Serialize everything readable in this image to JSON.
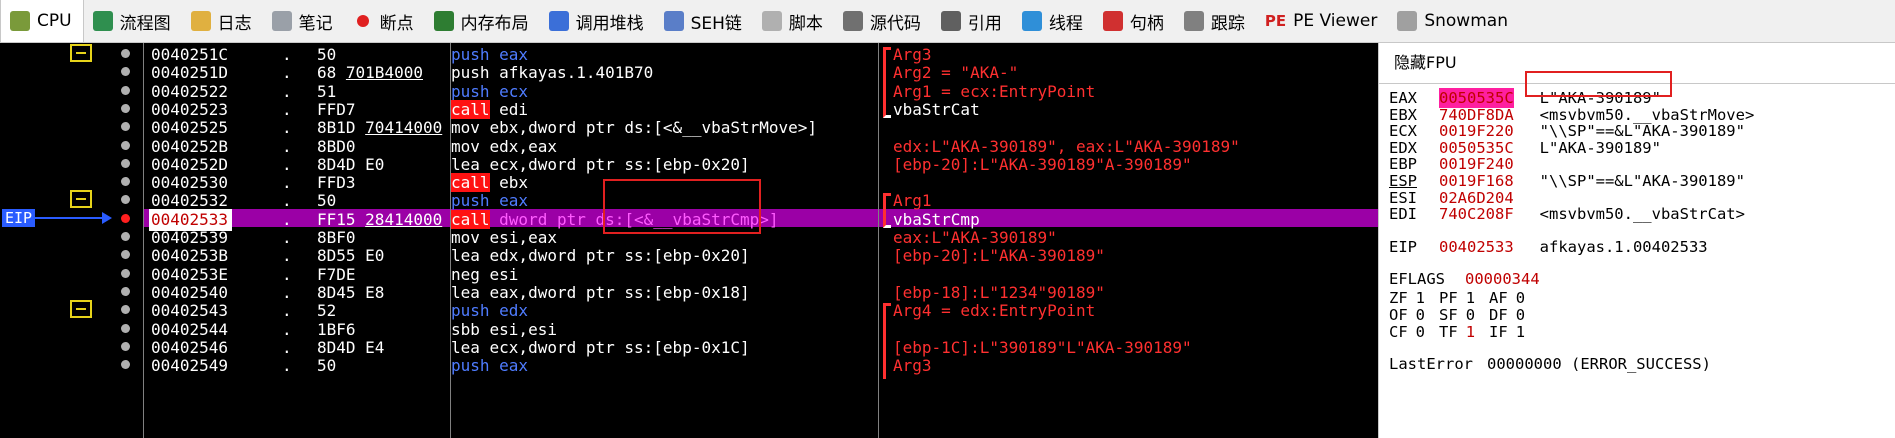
{
  "tabs": [
    {
      "label": "CPU",
      "icon": "cpu-icon",
      "active": true
    },
    {
      "label": "流程图",
      "icon": "graph-icon"
    },
    {
      "label": "日志",
      "icon": "log-icon"
    },
    {
      "label": "笔记",
      "icon": "notes-icon"
    },
    {
      "label": "断点",
      "icon": "breakpoint-icon"
    },
    {
      "label": "内存布局",
      "icon": "memory-map-icon"
    },
    {
      "label": "调用堆栈",
      "icon": "call-stack-icon"
    },
    {
      "label": "SEH链",
      "icon": "seh-icon"
    },
    {
      "label": "脚本",
      "icon": "script-icon"
    },
    {
      "label": "源代码",
      "icon": "source-icon"
    },
    {
      "label": "引用",
      "icon": "references-icon"
    },
    {
      "label": "线程",
      "icon": "threads-icon"
    },
    {
      "label": "句柄",
      "icon": "handles-icon"
    },
    {
      "label": "跟踪",
      "icon": "trace-icon"
    },
    {
      "label": "PE Viewer",
      "icon": "pe-viewer-icon"
    },
    {
      "label": "Snowman",
      "icon": "snowman-icon"
    }
  ],
  "eip_label": "EIP",
  "rows": [
    {
      "addr": "0040251C",
      "dot": ".",
      "bytes": "50",
      "bytes_ul": "",
      "instr": [
        [
          "push eax",
          "push"
        ]
      ],
      "comment": "Arg3",
      "ccls": "red"
    },
    {
      "addr": "0040251D",
      "dot": ".",
      "bytes": "68 ",
      "bytes_ul": "701B4000",
      "instr": [
        [
          "push afkayas.1.401B70",
          "w"
        ]
      ],
      "comment": "Arg2 = \"AKA-\"",
      "ccls": "red"
    },
    {
      "addr": "00402522",
      "dot": ".",
      "bytes": "51",
      "bytes_ul": "",
      "instr": [
        [
          "push ecx",
          "push"
        ]
      ],
      "comment": "Arg1 = ecx:EntryPoint",
      "ccls": "red"
    },
    {
      "addr": "00402523",
      "dot": ".",
      "bytes": "FFD7",
      "bytes_ul": "",
      "instr": [
        [
          "call",
          "call"
        ],
        [
          " edi",
          "w"
        ]
      ],
      "comment": "vbaStrCat",
      "ccls": "w"
    },
    {
      "addr": "00402525",
      "dot": ".",
      "bytes": "8B1D ",
      "bytes_ul": "70414000",
      "instr": [
        [
          "mov ebx,dword ptr ds:[<&__vbaStrMove>]",
          "w"
        ]
      ],
      "comment": "",
      "ccls": "red"
    },
    {
      "addr": "0040252B",
      "dot": ".",
      "bytes": "8BD0",
      "bytes_ul": "",
      "instr": [
        [
          "mov edx,eax",
          "w"
        ]
      ],
      "comment": "edx:L\"AKA-390189\", eax:L\"AKA-390189\"",
      "ccls": "red"
    },
    {
      "addr": "0040252D",
      "dot": ".",
      "bytes": "8D4D E0",
      "bytes_ul": "",
      "instr": [
        [
          "lea ecx,dword ptr ss:[ebp-0x20]",
          "w"
        ]
      ],
      "comment": "[ebp-20]:L\"AKA-390189\"A-390189\"",
      "ccls": "red"
    },
    {
      "addr": "00402530",
      "dot": ".",
      "bytes": "FFD3",
      "bytes_ul": "",
      "instr": [
        [
          "call",
          "call"
        ],
        [
          " ebx",
          "w"
        ]
      ],
      "comment": "",
      "ccls": "red"
    },
    {
      "addr": "00402532",
      "dot": ".",
      "bytes": "50",
      "bytes_ul": "",
      "instr": [
        [
          "push eax",
          "push"
        ]
      ],
      "comment": "Arg1",
      "ccls": "red"
    },
    {
      "addr": "00402533",
      "dot": ".",
      "bytes": "FF15 ",
      "bytes_ul": "28414000",
      "instr": [
        [
          "call",
          "call"
        ],
        [
          " dword ptr ds:[<&__vbaStrCmp>]",
          "mag"
        ]
      ],
      "comment": "vbaStrCmp",
      "ccls": "w"
    },
    {
      "addr": "00402539",
      "dot": ".",
      "bytes": "8BF0",
      "bytes_ul": "",
      "instr": [
        [
          "mov esi,eax",
          "w"
        ]
      ],
      "comment": "eax:L\"AKA-390189\"",
      "ccls": "red"
    },
    {
      "addr": "0040253B",
      "dot": ".",
      "bytes": "8D55 E0",
      "bytes_ul": "",
      "instr": [
        [
          "lea edx,dword ptr ss:[ebp-0x20]",
          "w"
        ]
      ],
      "comment": "[ebp-20]:L\"AKA-390189\"",
      "ccls": "red"
    },
    {
      "addr": "0040253E",
      "dot": ".",
      "bytes": "F7DE",
      "bytes_ul": "",
      "instr": [
        [
          "neg esi",
          "w"
        ]
      ],
      "comment": "",
      "ccls": "red"
    },
    {
      "addr": "00402540",
      "dot": ".",
      "bytes": "8D45 E8",
      "bytes_ul": "",
      "instr": [
        [
          "lea eax,dword ptr ss:[ebp-0x18]",
          "w"
        ]
      ],
      "comment": "[ebp-18]:L\"1234\"90189\"",
      "ccls": "red"
    },
    {
      "addr": "00402543",
      "dot": ".",
      "bytes": "52",
      "bytes_ul": "",
      "instr": [
        [
          "push edx",
          "push"
        ]
      ],
      "comment": "Arg4 = edx:EntryPoint",
      "ccls": "red"
    },
    {
      "addr": "00402544",
      "dot": ".",
      "bytes": "1BF6",
      "bytes_ul": "",
      "instr": [
        [
          "sbb esi,esi",
          "w"
        ]
      ],
      "comment": "",
      "ccls": "red"
    },
    {
      "addr": "00402546",
      "dot": ".",
      "bytes": "8D4D E4",
      "bytes_ul": "",
      "instr": [
        [
          "lea ecx,dword ptr ss:[ebp-0x1C]",
          "w"
        ]
      ],
      "comment": "[ebp-1C]:L\"390189\"L\"AKA-390189\"",
      "ccls": "red"
    },
    {
      "addr": "00402549",
      "dot": ".",
      "bytes": "50",
      "bytes_ul": "",
      "instr": [
        [
          "push eax",
          "push"
        ]
      ],
      "comment": "Arg3",
      "ccls": "red"
    }
  ],
  "registers": {
    "header": "隐藏FPU",
    "lines": [
      {
        "name": "EAX",
        "value": "0050535C",
        "comment": "L\"AKA-390189\"",
        "vcls": "mag"
      },
      {
        "name": "EBX",
        "value": "740DF8DA",
        "comment": "<msvbvm50.__vbaStrMove>",
        "vcls": "red"
      },
      {
        "name": "ECX",
        "value": "0019F220",
        "comment": "\"\\\\SP\"==&L\"AKA-390189\"",
        "vcls": "red"
      },
      {
        "name": "EDX",
        "value": "0050535C",
        "comment": "L\"AKA-390189\"",
        "vcls": "red"
      },
      {
        "name": "EBP",
        "value": "0019F240",
        "comment": "",
        "vcls": "red"
      },
      {
        "name": "ESP",
        "value": "0019F168",
        "comment": "\"\\\\SP\"==&L\"AKA-390189\"",
        "vcls": "red"
      },
      {
        "name": "ESI",
        "value": "02A6D204",
        "comment": "",
        "vcls": "red"
      },
      {
        "name": "EDI",
        "value": "740C208F",
        "comment": "<msvbvm50.__vbaStrCat>",
        "vcls": "red"
      },
      {
        "name": "EIP",
        "value": "00402533",
        "comment": "afkayas.1.00402533",
        "vcls": "red"
      },
      {
        "name": "EFLAGS",
        "value": "00000344",
        "comment": "",
        "vcls": "red"
      }
    ],
    "flags": [
      [
        "ZF",
        "1",
        "PF",
        "1",
        "AF",
        "0"
      ],
      [
        "OF",
        "0",
        "SF",
        "0",
        "DF",
        "0"
      ],
      [
        "CF",
        "0",
        "TF",
        "1",
        "IF",
        "1"
      ]
    ],
    "lasterror_label": "LastError",
    "lasterror_value": "00000000 (ERROR_SUCCESS)"
  },
  "colors": {
    "highlight_row": "#9b00a6",
    "call_bg": "#ff1212",
    "push": "#4f7cff",
    "comment": "#ff3030",
    "jump_box": "#e7d41a",
    "eip_arrow": "#2a5cff",
    "annotation_box": "#e12020"
  }
}
